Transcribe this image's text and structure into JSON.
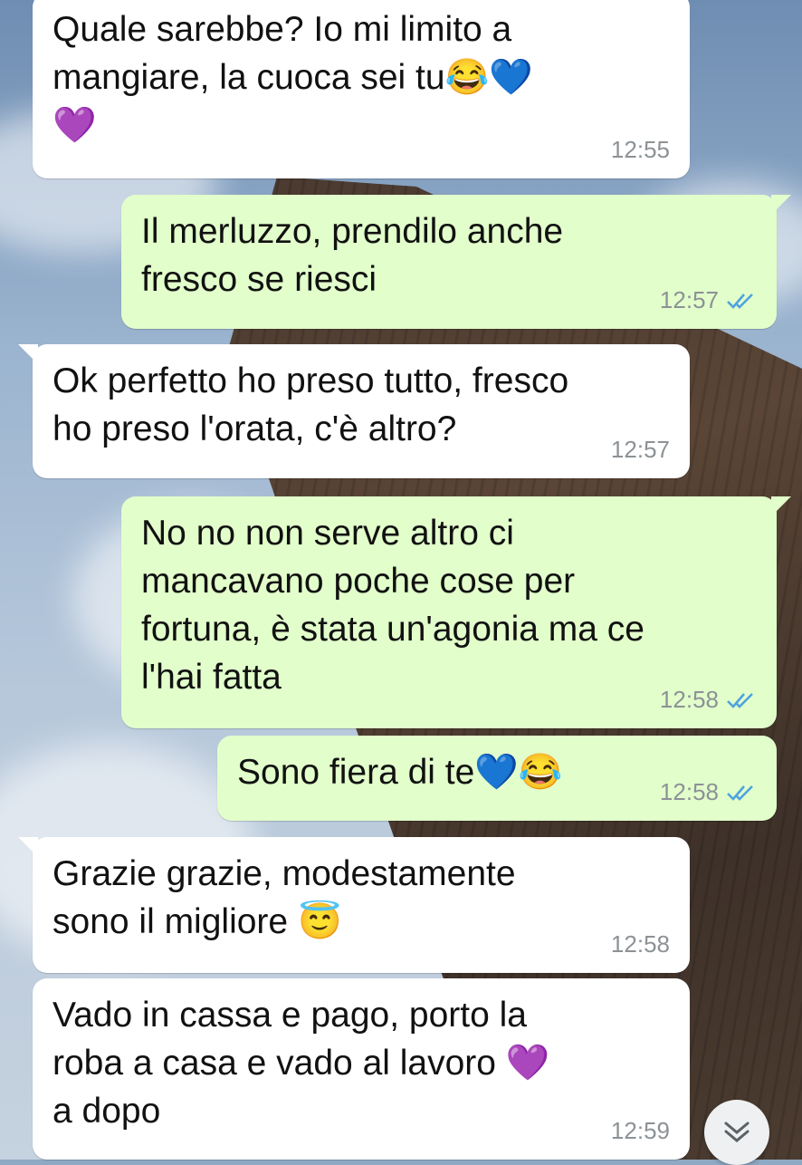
{
  "colors": {
    "incoming_bubble": "#ffffff",
    "outgoing_bubble": "#e2fecb",
    "timestamp": "#8c9296",
    "read_ticks": "#4fa3e0"
  },
  "messages": [
    {
      "direction": "in",
      "text": "Quale sarebbe? Io mi limito a\nmangiare, la cuoca sei tu😂💙\n💜",
      "time": "12:55"
    },
    {
      "direction": "out",
      "text": "Il merluzzo, prendilo anche\nfresco se riesci",
      "time": "12:57",
      "status": "read"
    },
    {
      "direction": "in",
      "text": "Ok perfetto ho preso tutto, fresco\nho preso l'orata, c'è altro?",
      "time": "12:57"
    },
    {
      "direction": "out",
      "text": "No no non serve altro ci\nmancavano poche cose per\nfortuna, è stata un'agonia ma ce\nl'hai fatta",
      "time": "12:58",
      "status": "read"
    },
    {
      "direction": "out",
      "text": "Sono fiera di te💙😂",
      "time": "12:58",
      "status": "read"
    },
    {
      "direction": "in",
      "text": "Grazie grazie, modestamente\nsono il migliore 😇",
      "time": "12:58"
    },
    {
      "direction": "in",
      "text": "Vado in cassa e pago, porto la\nroba a casa e vado al lavoro 💜\na dopo",
      "time": "12:59"
    }
  ],
  "scroll_down_button": {
    "icon": "double-chevron-down-icon"
  }
}
